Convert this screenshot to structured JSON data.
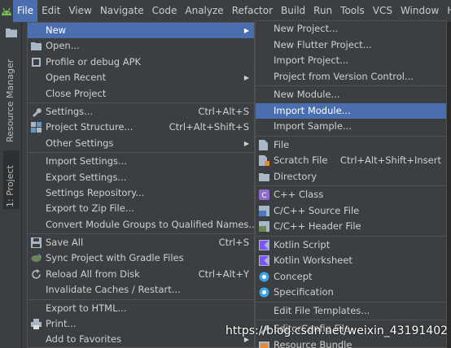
{
  "menubar": {
    "items": [
      {
        "label": "File",
        "active": true
      },
      {
        "label": "Edit"
      },
      {
        "label": "View"
      },
      {
        "label": "Navigate"
      },
      {
        "label": "Code"
      },
      {
        "label": "Analyze"
      },
      {
        "label": "Refactor"
      },
      {
        "label": "Build"
      },
      {
        "label": "Run"
      },
      {
        "label": "Tools"
      },
      {
        "label": "VCS"
      },
      {
        "label": "Window"
      },
      {
        "label": "He"
      }
    ]
  },
  "toolstrip": {
    "tabs": [
      {
        "label": "Resource Manager"
      },
      {
        "label": "1: Project"
      }
    ]
  },
  "file_menu": {
    "items": [
      {
        "label": "New",
        "shortcut": "",
        "submenu": true,
        "highlighted": true,
        "icon": ""
      },
      {
        "label": "Open...",
        "shortcut": "",
        "icon": "folder-icon"
      },
      {
        "label": "Profile or debug APK",
        "shortcut": "",
        "icon": "apk-icon"
      },
      {
        "label": "Open Recent",
        "shortcut": "",
        "submenu": true,
        "icon": ""
      },
      {
        "label": "Close Project",
        "shortcut": "",
        "icon": ""
      },
      {
        "separator": true
      },
      {
        "label": "Settings...",
        "shortcut": "Ctrl+Alt+S",
        "icon": "wrench-icon"
      },
      {
        "label": "Project Structure...",
        "shortcut": "Ctrl+Alt+Shift+S",
        "icon": "project-structure-icon"
      },
      {
        "label": "Other Settings",
        "shortcut": "",
        "submenu": true,
        "icon": ""
      },
      {
        "separator": true
      },
      {
        "label": "Import Settings...",
        "shortcut": "",
        "icon": ""
      },
      {
        "label": "Export Settings...",
        "shortcut": "",
        "icon": ""
      },
      {
        "label": "Settings Repository...",
        "shortcut": "",
        "icon": ""
      },
      {
        "label": "Export to Zip File...",
        "shortcut": "",
        "icon": ""
      },
      {
        "label": "Convert Module Groups to Qualified Names...",
        "shortcut": "",
        "icon": ""
      },
      {
        "separator": true
      },
      {
        "label": "Save All",
        "shortcut": "Ctrl+S",
        "icon": "save-icon"
      },
      {
        "label": "Sync Project with Gradle Files",
        "shortcut": "",
        "icon": "gradle-sync-icon"
      },
      {
        "label": "Reload All from Disk",
        "shortcut": "Ctrl+Alt+Y",
        "icon": "reload-icon"
      },
      {
        "label": "Invalidate Caches / Restart...",
        "shortcut": "",
        "icon": ""
      },
      {
        "separator": true
      },
      {
        "label": "Export to HTML...",
        "shortcut": "",
        "icon": ""
      },
      {
        "label": "Print...",
        "shortcut": "",
        "icon": "print-icon"
      },
      {
        "label": "Add to Favorites",
        "shortcut": "",
        "submenu": true,
        "icon": ""
      }
    ]
  },
  "new_menu": {
    "items": [
      {
        "label": "New Project...",
        "icon": ""
      },
      {
        "label": "New Flutter Project...",
        "icon": ""
      },
      {
        "label": "Import Project...",
        "icon": ""
      },
      {
        "label": "Project from Version Control...",
        "icon": ""
      },
      {
        "separator": true
      },
      {
        "label": "New Module...",
        "icon": ""
      },
      {
        "label": "Import Module...",
        "icon": "",
        "highlighted": true
      },
      {
        "label": "Import Sample...",
        "icon": ""
      },
      {
        "separator": true
      },
      {
        "label": "File",
        "icon": "file-icon"
      },
      {
        "label": "Scratch File",
        "shortcut": "Ctrl+Alt+Shift+Insert",
        "icon": "scratch-file-icon"
      },
      {
        "label": "Directory",
        "icon": "directory-icon"
      },
      {
        "separator": true
      },
      {
        "label": "C++ Class",
        "icon": "cpp-class-icon"
      },
      {
        "label": "C/C++ Source File",
        "icon": "cpp-source-icon"
      },
      {
        "label": "C/C++ Header File",
        "icon": "cpp-header-icon"
      },
      {
        "separator": true
      },
      {
        "label": "Kotlin Script",
        "icon": "kotlin-icon"
      },
      {
        "label": "Kotlin Worksheet",
        "icon": "kotlin-icon"
      },
      {
        "label": "Concept",
        "icon": "concept-icon"
      },
      {
        "label": "Specification",
        "icon": "specification-icon"
      },
      {
        "separator": true
      },
      {
        "label": "Edit File Templates...",
        "icon": ""
      },
      {
        "separator": true
      },
      {
        "label": "EditorConfig File",
        "icon": "editorconfig-icon"
      },
      {
        "label": "Resource Bundle",
        "icon": "resource-bundle-icon"
      }
    ]
  },
  "watermark": "https://blog.csdn.net/weixin_43191402",
  "colors": {
    "menu_bg": "#3c3f41",
    "highlight": "#4b6eaf",
    "text": "#cfcfcf",
    "separator": "#515151"
  }
}
